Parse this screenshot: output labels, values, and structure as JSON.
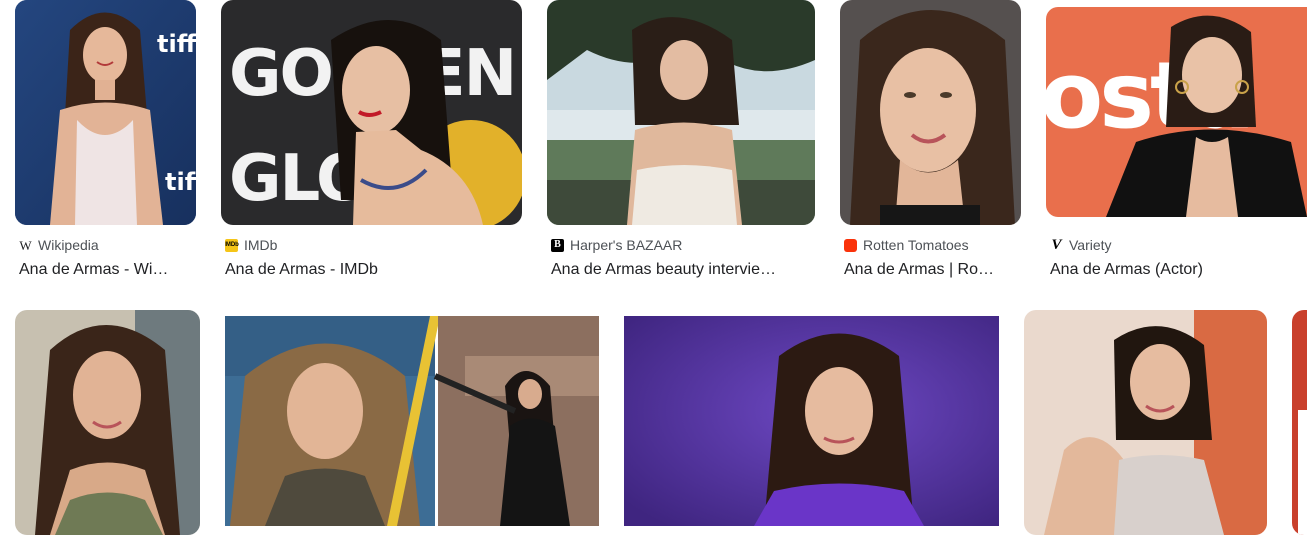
{
  "results_row_1": [
    {
      "source": "Wikipedia",
      "favicon": "wikipedia-icon",
      "favicon_text": "W",
      "title": "Ana de Armas - Wi…"
    },
    {
      "source": "IMDb",
      "favicon": "imdb-icon",
      "favicon_text": "IMDb",
      "title": "Ana de Armas - IMDb"
    },
    {
      "source": "Harper's BAZAAR",
      "favicon": "bazaar-icon",
      "favicon_text": "B",
      "title": "Ana de Armas beauty intervie…"
    },
    {
      "source": "Rotten Tomatoes",
      "favicon": "rotten-tomatoes-icon",
      "favicon_text": "",
      "title": "Ana de Armas | Ro…"
    },
    {
      "source": "Variety",
      "favicon": "variety-icon",
      "favicon_text": "V",
      "title": "Ana de Armas (Actor)"
    }
  ],
  "image_text": {
    "tiff_logo": "tiff",
    "golden_globe_line1": "GOLDEN",
    "golden_globe_line2": "GLOBE",
    "backdrop_text": "ostu"
  },
  "colors": {
    "source_text": "#4d5156",
    "title_text": "#202124",
    "imdb_yellow": "#f5c518",
    "rt_red": "#fa320a",
    "purple_backdrop": "#4b2d8c"
  }
}
